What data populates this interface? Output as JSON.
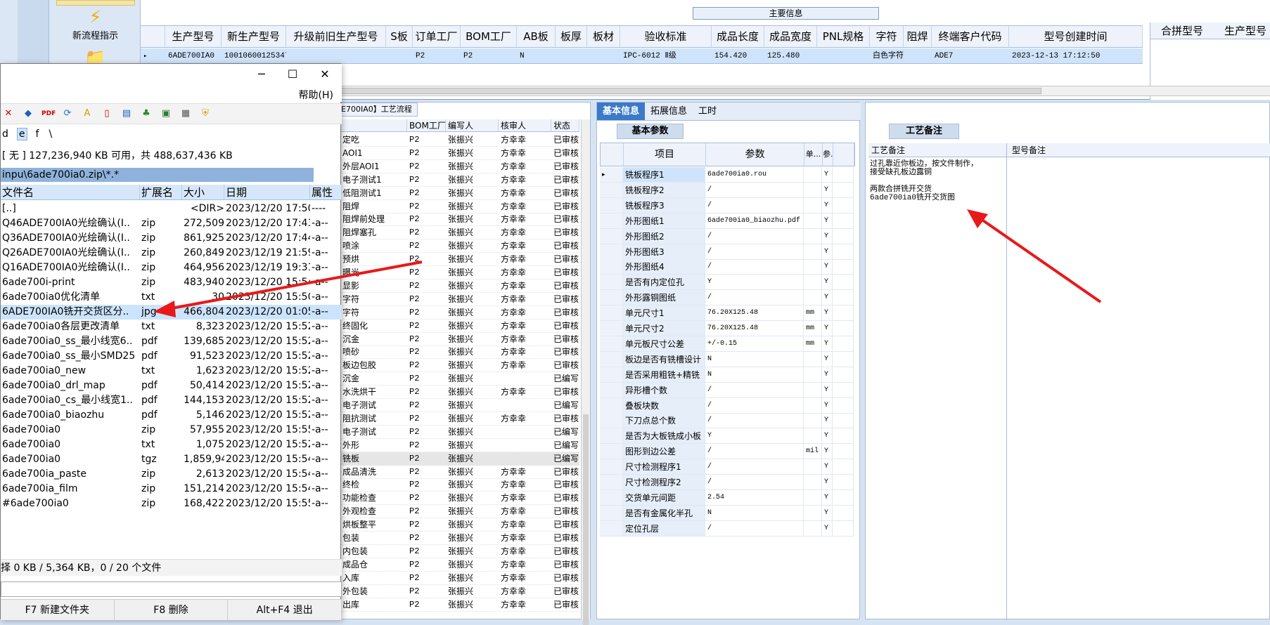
{
  "ribbon": {
    "tool1_label": "新流程指示"
  },
  "main": {
    "title": "主要信息",
    "columns": [
      "生产型号",
      "新生产型号",
      "升级前旧生产型号",
      "S板",
      "订单工厂",
      "BOM工厂",
      "AB板",
      "板厚",
      "板材",
      "验收标准",
      "成品长度",
      "成品宽度",
      "PNL规格",
      "字符",
      "阻焊",
      "终端客户代码",
      "型号创建时间"
    ],
    "row": [
      "6ADE700IA0",
      "10010600125347",
      "",
      "",
      "P2",
      "P2",
      "N",
      "",
      "",
      "IPC-6012 Ⅱ级",
      "154.420",
      "125.480",
      "",
      "白色字符",
      "",
      "ADE7",
      "2023-12-13 17:12:50"
    ],
    "right_columns": [
      "合拼型号",
      "生产型号"
    ]
  },
  "process": {
    "tab": "E700IA0】工艺流程",
    "columns": [
      "",
      "BOM工厂",
      "编写人",
      "核审人",
      "状态"
    ],
    "rows": [
      [
        "定吃",
        "P2",
        "张振兴",
        "方幸幸",
        "已审核"
      ],
      [
        "AOI1",
        "P2",
        "张振兴",
        "方幸幸",
        "已审核"
      ],
      [
        "外层AOI1",
        "P2",
        "张振兴",
        "方幸幸",
        "已审核"
      ],
      [
        "电子测试1",
        "P2",
        "张振兴",
        "方幸幸",
        "已审核"
      ],
      [
        "低阻测试1",
        "P2",
        "张振兴",
        "方幸幸",
        "已审核"
      ],
      [
        "阻焊",
        "P2",
        "张振兴",
        "方幸幸",
        "已审核"
      ],
      [
        "阻焊前处理",
        "P2",
        "张振兴",
        "方幸幸",
        "已审核"
      ],
      [
        "阻焊塞孔",
        "P2",
        "张振兴",
        "方幸幸",
        "已审核"
      ],
      [
        "喷涂",
        "P2",
        "张振兴",
        "方幸幸",
        "已审核"
      ],
      [
        "预烘",
        "P2",
        "张振兴",
        "方幸幸",
        "已审核"
      ],
      [
        "曝光",
        "P2",
        "张振兴",
        "方幸幸",
        "已审核"
      ],
      [
        "显影",
        "P2",
        "张振兴",
        "方幸幸",
        "已审核"
      ],
      [
        "字符",
        "P2",
        "张振兴",
        "方幸幸",
        "已审核"
      ],
      [
        "字符",
        "P2",
        "张振兴",
        "方幸幸",
        "已审核"
      ],
      [
        "终固化",
        "P2",
        "张振兴",
        "方幸幸",
        "已审核"
      ],
      [
        "沉金",
        "P2",
        "张振兴",
        "方幸幸",
        "已审核"
      ],
      [
        "喷砂",
        "P2",
        "张振兴",
        "方幸幸",
        "已审核"
      ],
      [
        "板边包胶",
        "P2",
        "张振兴",
        "方幸幸",
        "已审核"
      ],
      [
        "沉金",
        "P2",
        "张振兴",
        "",
        "已编写"
      ],
      [
        "水洗烘干",
        "P2",
        "张振兴",
        "方幸幸",
        "已审核"
      ],
      [
        "电子测试",
        "P2",
        "张振兴",
        "",
        "已编写"
      ],
      [
        "阻抗测试",
        "P2",
        "张振兴",
        "方幸幸",
        "已审核"
      ],
      [
        "电子测试",
        "P2",
        "张振兴",
        "",
        "已编写"
      ],
      [
        "外形",
        "P2",
        "张振兴",
        "",
        "已编写"
      ],
      [
        "铣板",
        "P2",
        "张振兴",
        "",
        "已编写"
      ],
      [
        "成品清洗",
        "P2",
        "张振兴",
        "方幸幸",
        "已审核"
      ],
      [
        "终检",
        "P2",
        "张振兴",
        "方幸幸",
        "已审核"
      ],
      [
        "功能检查",
        "P2",
        "张振兴",
        "方幸幸",
        "已审核"
      ],
      [
        "外观检查",
        "P2",
        "张振兴",
        "方幸幸",
        "已审核"
      ],
      [
        "烘板整平",
        "P2",
        "张振兴",
        "方幸幸",
        "已审核"
      ],
      [
        "包装",
        "P2",
        "张振兴",
        "方幸幸",
        "已审核"
      ],
      [
        "内包装",
        "P2",
        "张振兴",
        "方幸幸",
        "已审核"
      ],
      [
        "成品仓",
        "P2",
        "张振兴",
        "方幸幸",
        "已审核"
      ],
      [
        "入库",
        "P2",
        "张振兴",
        "方幸幸",
        "已审核"
      ],
      [
        "外包装",
        "P2",
        "张振兴",
        "方幸幸",
        "已审核"
      ],
      [
        "出库",
        "P2",
        "张振兴",
        "方幸幸",
        "已审核"
      ]
    ]
  },
  "basic": {
    "tabs": [
      "基本信息",
      "拓展信息",
      "工时"
    ],
    "sub_tab": "基本参数",
    "columns": [
      "项目",
      "参数",
      "单...",
      "参."
    ],
    "rows": [
      [
        "铣板程序1",
        "6ade700ia0.rou",
        "",
        "Y"
      ],
      [
        "铣板程序2",
        "/",
        "",
        "Y"
      ],
      [
        "铣板程序3",
        "/",
        "",
        "Y"
      ],
      [
        "外形图纸1",
        "6ade700ia0_biaozhu.pdf",
        "",
        "Y"
      ],
      [
        "外形图纸2",
        "/",
        "",
        "Y"
      ],
      [
        "外形图纸3",
        "/",
        "",
        "Y"
      ],
      [
        "外形图纸4",
        "/",
        "",
        "Y"
      ],
      [
        "是否有内定位孔",
        "Y",
        "",
        "Y"
      ],
      [
        "外形露铜图纸",
        "/",
        "",
        "Y"
      ],
      [
        "单元尺寸1",
        "76.20X125.48",
        "mm",
        "Y"
      ],
      [
        "单元尺寸2",
        "76.20X125.48",
        "mm",
        "Y"
      ],
      [
        "单元板尺寸公差",
        "+/-0.15",
        "mm",
        "Y"
      ],
      [
        "板边是否有铣槽设计",
        "N",
        "",
        "Y"
      ],
      [
        "是否采用粗铣+精铣",
        "N",
        "",
        "Y"
      ],
      [
        "异形槽个数",
        "/",
        "",
        "Y"
      ],
      [
        "叠板块数",
        "/",
        "",
        "Y"
      ],
      [
        "下刀点总个数",
        "/",
        "",
        "Y"
      ],
      [
        "是否为大板铣成小板",
        "Y",
        "",
        "Y"
      ],
      [
        "图形到边公差",
        "/",
        "mil",
        "Y"
      ],
      [
        "尺寸检测程序1",
        "/",
        "",
        "Y"
      ],
      [
        "尺寸检测程序2",
        "/",
        "",
        "Y"
      ],
      [
        "交货单元间距",
        "2.54",
        "",
        "Y"
      ],
      [
        "是否有金属化半孔",
        "N",
        "",
        "Y"
      ],
      [
        "定位孔层",
        "/",
        "",
        "Y"
      ]
    ]
  },
  "notes": {
    "tab": "工艺备注",
    "col1": "工艺备注",
    "col2": "型号备注",
    "text": "过孔靠近你板边，按文件制作，\n接受缺孔板边露铜\n\n两款合拼铣开交货\n6ade700ia0铣开交货图"
  },
  "fm": {
    "menu_help": "帮助(H)",
    "drives": [
      "d",
      "e",
      "f",
      "\\"
    ],
    "free": "[ 无 ]  127,236,940 KB 可用，共 488,637,436 KB",
    "path": "inpu\\6ade700ia0.zip\\*.*",
    "columns": [
      "文件名",
      "扩展名",
      "大小",
      "日期",
      "属性"
    ],
    "files": [
      [
        "[..]",
        "",
        "<DIR>",
        "2023/12/20 17:50",
        "----"
      ],
      [
        "Q46ADE700IA0光绘确认(I..",
        "zip",
        "272,509",
        "2023/12/20 17:43",
        "-a--"
      ],
      [
        "Q36ADE700IA0光绘确认(I..",
        "zip",
        "861,925",
        "2023/12/20 17:44",
        "-a--"
      ],
      [
        "Q26ADE700IA0光绘确认(I..",
        "zip",
        "260,849",
        "2023/12/19 21:59",
        "-a--"
      ],
      [
        "Q16ADE700IA0光绘确认(I..",
        "zip",
        "464,956",
        "2023/12/19 19:31",
        "-a--"
      ],
      [
        "6ade700i-print",
        "zip",
        "483,940",
        "2023/12/20 15:54",
        "-a--"
      ],
      [
        "6ade700ia0优化清单",
        "txt",
        "30",
        "2023/12/20 15:50",
        "-a--"
      ],
      [
        "6ADE700IA0铣开交货区分..",
        "jpg",
        "466,804",
        "2023/12/20 01:05",
        "-a--"
      ],
      [
        "6ade700ia0各层更改清单",
        "txt",
        "8,323",
        "2023/12/20 15:52",
        "-a--"
      ],
      [
        "6ade700ia0_ss_最小线宽6..",
        "pdf",
        "139,685",
        "2023/12/20 15:52",
        "-a--"
      ],
      [
        "6ade700ia0_ss_最小SMD25",
        "pdf",
        "91,523",
        "2023/12/20 15:52",
        "-a--"
      ],
      [
        "6ade700ia0_new",
        "txt",
        "1,623",
        "2023/12/20 15:52",
        "-a--"
      ],
      [
        "6ade700ia0_drl_map",
        "pdf",
        "50,414",
        "2023/12/20 15:52",
        "-a--"
      ],
      [
        "6ade700ia0_cs_最小线宽1..",
        "pdf",
        "144,153",
        "2023/12/20 15:52",
        "-a--"
      ],
      [
        "6ade700ia0_biaozhu",
        "pdf",
        "5,146",
        "2023/12/20 15:52",
        "-a--"
      ],
      [
        "6ade700ia0",
        "zip",
        "57,955",
        "2023/12/20 15:55",
        "-a--"
      ],
      [
        "6ade700ia0",
        "txt",
        "1,075",
        "2023/12/20 15:52",
        "-a--"
      ],
      [
        "6ade700ia0",
        "tgz",
        "1,859,947",
        "2023/12/20 15:54",
        "-a--"
      ],
      [
        "6ade700ia_paste",
        "zip",
        "2,613",
        "2023/12/20 15:54",
        "-a--"
      ],
      [
        "6ade700ia_film",
        "zip",
        "151,214",
        "2023/12/20 15:54",
        "-a--"
      ],
      [
        "#6ade700ia0",
        "zip",
        "168,422",
        "2023/12/20 15:55",
        "-a--"
      ]
    ],
    "status": "择 0 KB / 5,364 KB，0 / 20 个文件",
    "fkeys": [
      "F7 新建文件夹",
      "F8 删除",
      "Alt+F4 退出"
    ]
  },
  "colors": {
    "arrow": "#e8191a",
    "accent": "#3b79c9",
    "selection": "#cfe4fb"
  }
}
